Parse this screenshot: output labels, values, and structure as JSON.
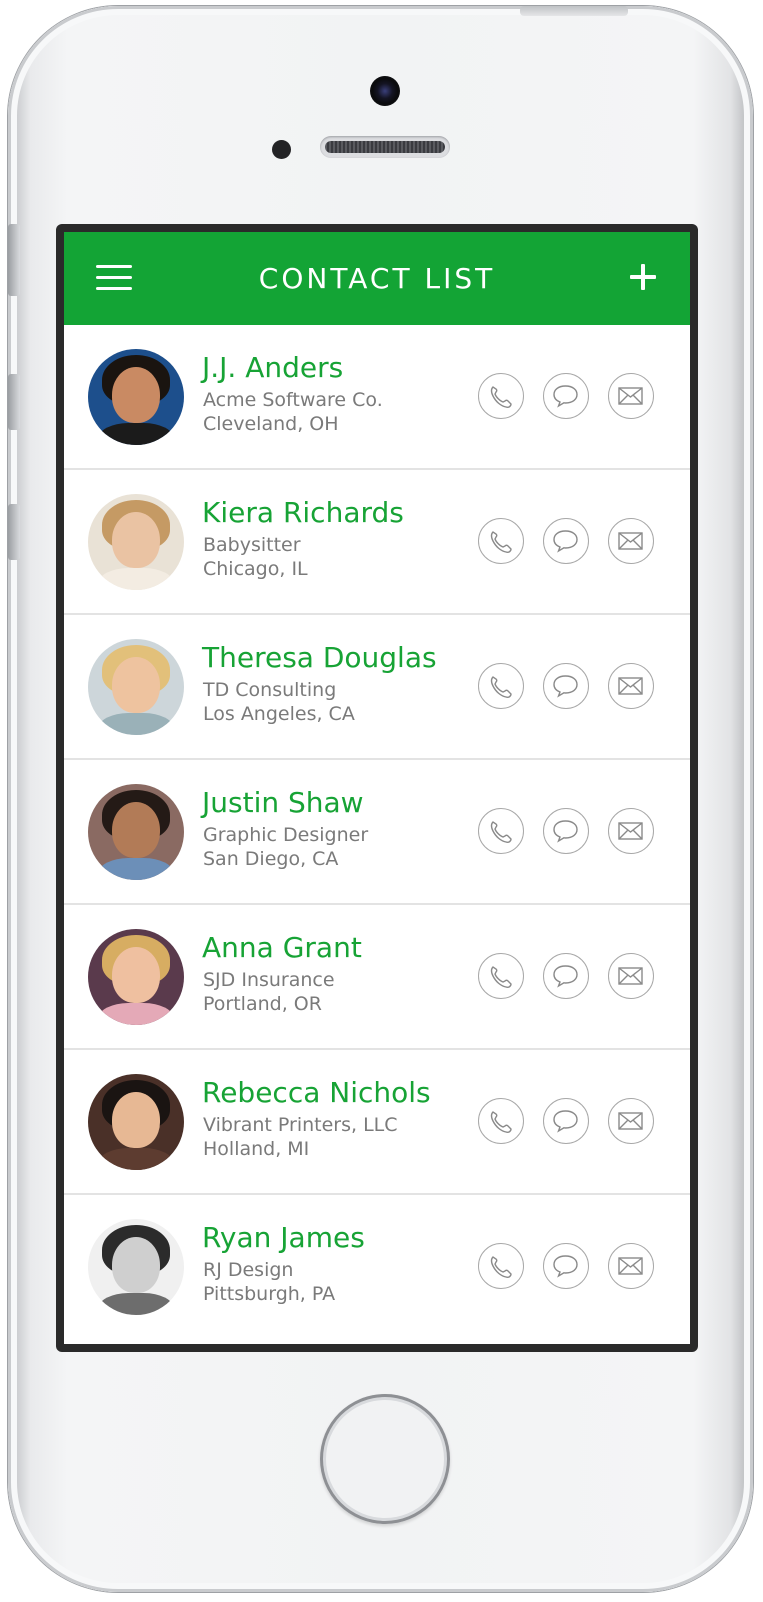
{
  "app": {
    "title": "CONTACT LIST",
    "menu_icon": "hamburger-menu-icon",
    "add_icon": "plus-icon",
    "accent_color": "#13a435",
    "name_color": "#17a335"
  },
  "contacts": [
    {
      "name": "J.J. Anders",
      "line1": "Acme Software Co.",
      "line2": "Cleveland, OH"
    },
    {
      "name": "Kiera Richards",
      "line1": "Babysitter",
      "line2": "Chicago, IL"
    },
    {
      "name": "Theresa Douglas",
      "line1": "TD Consulting",
      "line2": "Los Angeles, CA"
    },
    {
      "name": "Justin Shaw",
      "line1": "Graphic Designer",
      "line2": "San Diego, CA"
    },
    {
      "name": "Anna Grant",
      "line1": "SJD Insurance",
      "line2": "Portland, OR"
    },
    {
      "name": "Rebecca Nichols",
      "line1": "Vibrant Printers, LLC",
      "line2": "Holland, MI"
    },
    {
      "name": "Ryan James",
      "line1": "RJ Design",
      "line2": "Pittsburgh, PA"
    }
  ],
  "actions": [
    "phone-icon",
    "chat-bubble-icon",
    "envelope-icon"
  ]
}
